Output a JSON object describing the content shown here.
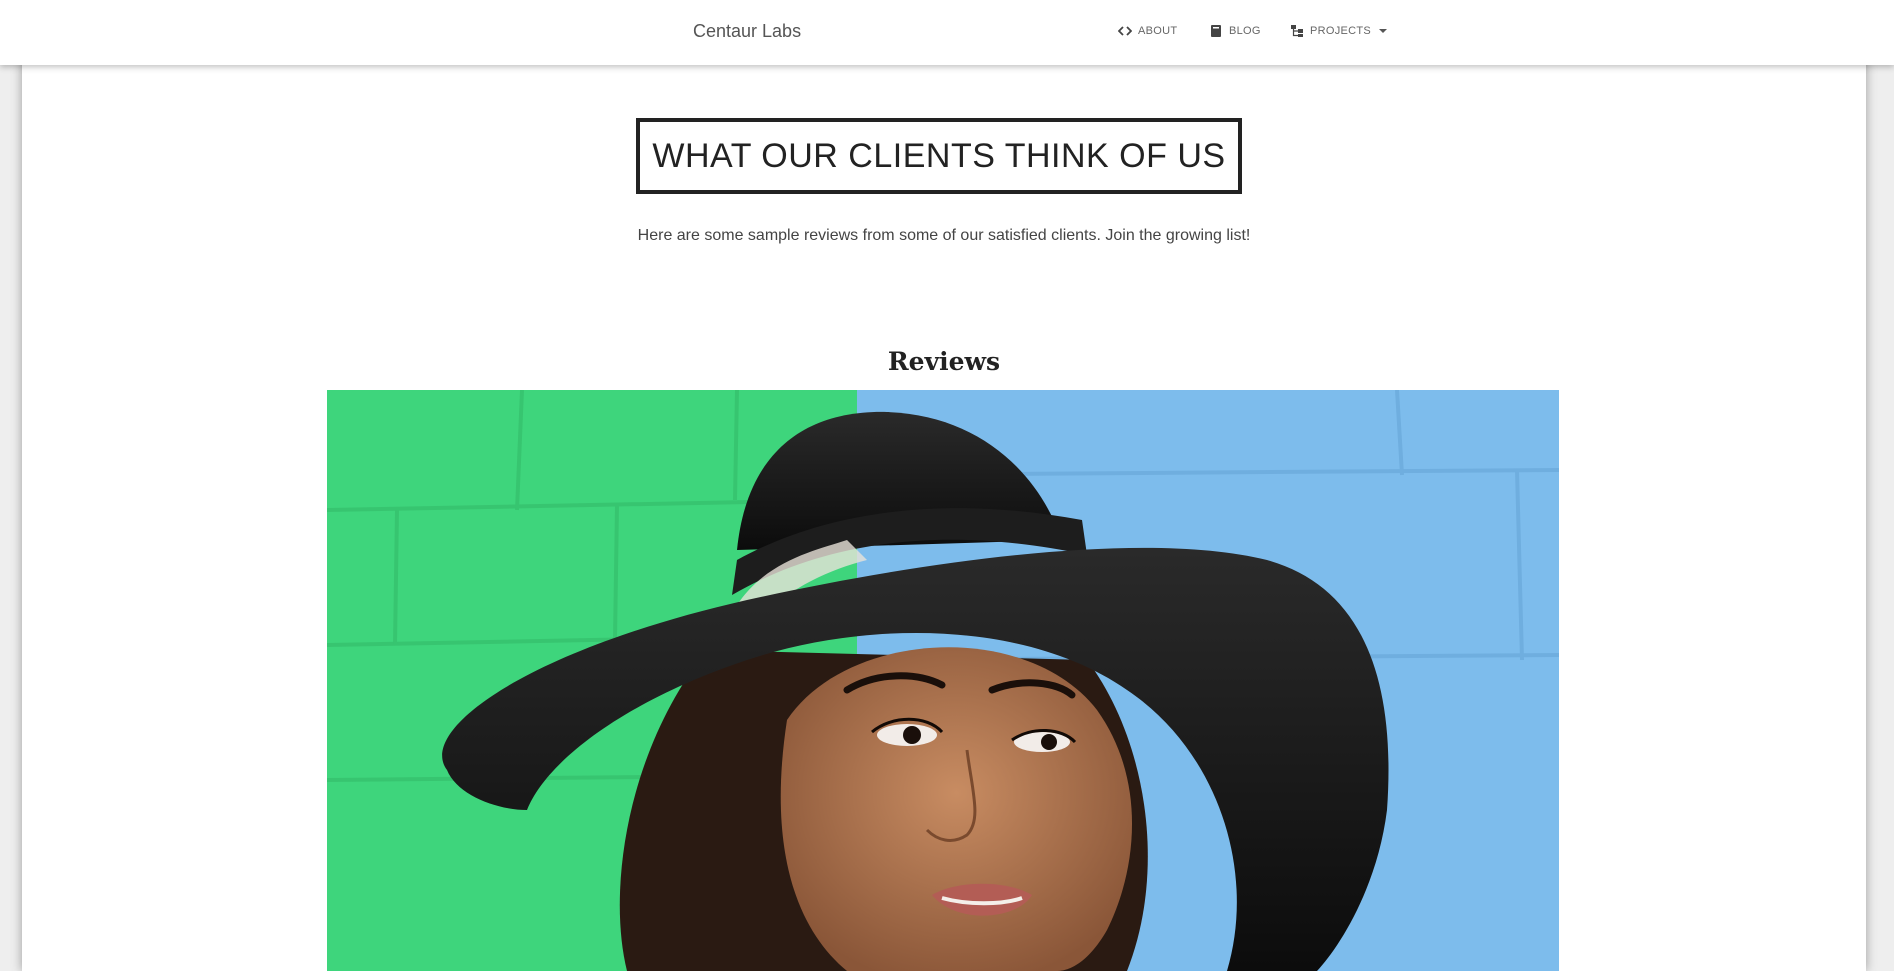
{
  "navbar": {
    "brand": "Centaur Labs",
    "items": [
      {
        "label": "ABOUT",
        "icon": "code-icon"
      },
      {
        "label": "BLOG",
        "icon": "book-icon"
      },
      {
        "label": "PROJECTS",
        "icon": "sitemap-icon"
      }
    ]
  },
  "main": {
    "title": "WHAT OUR CLIENTS THINK OF US",
    "subtitle": "Here are some sample reviews from some of our satisfied clients. Join the growing list!",
    "reviews_heading": "Reviews",
    "photo_description": "woman-in-black-hat"
  },
  "colors": {
    "green_wall": "#3dd67a",
    "blue_wall": "#79b9ea",
    "hat": "#141414",
    "skin": "#b27a55"
  }
}
